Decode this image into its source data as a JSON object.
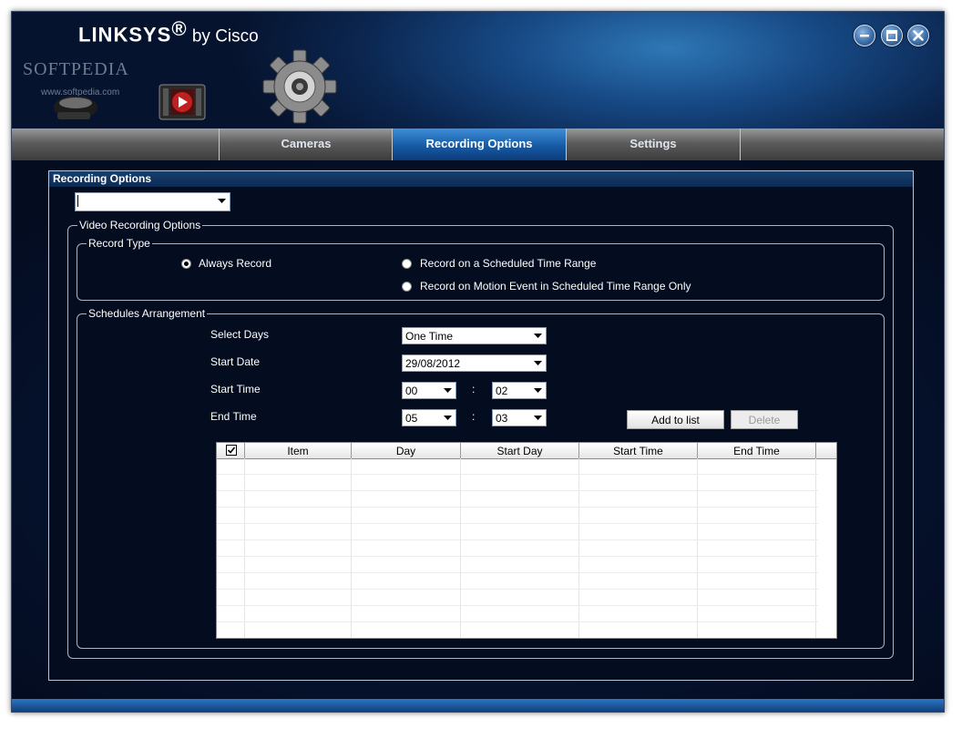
{
  "header": {
    "brand": "LINKSYS",
    "brand_mark": "®",
    "brand_suffix": " by Cisco",
    "watermark": "SOFTPEDIA",
    "watermark_url": "www.softpedia.com"
  },
  "icons": {
    "app_icons": [
      "camera-icon",
      "film-icon",
      "gear-icon"
    ],
    "window_buttons": [
      "minimize-icon",
      "maximize-icon",
      "close-icon"
    ]
  },
  "tabs": [
    {
      "label": "Cameras",
      "active": false
    },
    {
      "label": "Recording Options",
      "active": true
    },
    {
      "label": "Settings",
      "active": false
    }
  ],
  "panel": {
    "title": "Recording Options",
    "profile_value": ""
  },
  "video_options": {
    "legend": "Video Recording Options",
    "record_type": {
      "legend": "Record Type",
      "options": [
        {
          "label": "Always Record",
          "checked": true
        },
        {
          "label": "Record on a Scheduled Time Range",
          "checked": false
        },
        {
          "label": "Record on Motion Event in Scheduled Time Range Only",
          "checked": false
        }
      ]
    },
    "schedules": {
      "legend": "Schedules Arrangement",
      "select_days_label": "Select Days",
      "select_days_value": "One Time",
      "start_date_label": "Start Date",
      "start_date_value": "29/08/2012",
      "start_time_label": "Start Time",
      "start_time_hour": "00",
      "start_time_minute": "02",
      "end_time_label": "End Time",
      "end_time_hour": "05",
      "end_time_minute": "03",
      "time_separator": ":",
      "add_button": "Add to list",
      "delete_button": "Delete",
      "delete_enabled": false,
      "table": {
        "columns": [
          "Item",
          "Day",
          "Start Day",
          "Start Time",
          "End Time"
        ],
        "header_checkbox_checked": true,
        "rows": []
      }
    }
  },
  "colors": {
    "accent_blue": "#175aa4",
    "window_background": "#06102a"
  }
}
